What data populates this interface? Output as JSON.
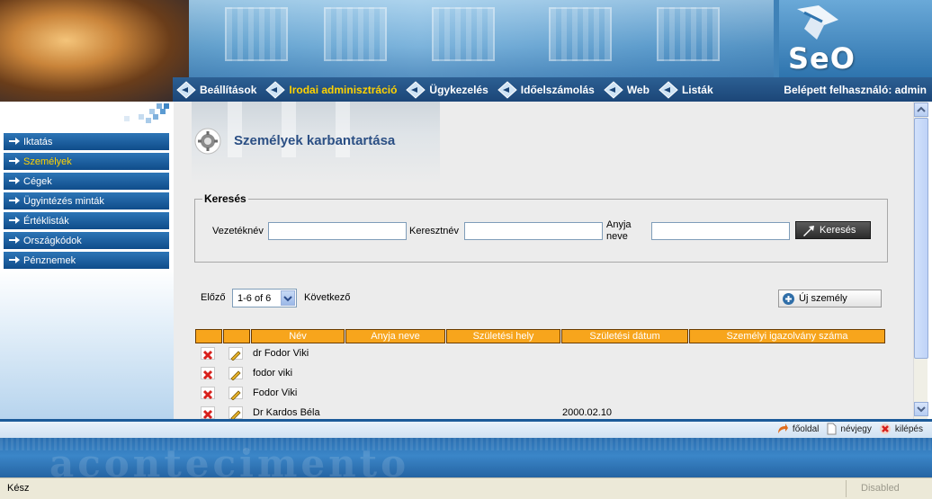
{
  "logo": {
    "text": "SeO"
  },
  "nav": {
    "items": [
      {
        "label": "Beállítások",
        "active": false
      },
      {
        "label": "Irodai adminisztráció",
        "active": true
      },
      {
        "label": "Ügykezelés",
        "active": false
      },
      {
        "label": "Időelszámolás",
        "active": false
      },
      {
        "label": "Web",
        "active": false
      },
      {
        "label": "Listák",
        "active": false
      }
    ],
    "user_label": "Belépett felhasználó: admin"
  },
  "sidebar": {
    "items": [
      {
        "label": "Iktatás",
        "active": false
      },
      {
        "label": "Személyek",
        "active": true
      },
      {
        "label": "Cégek",
        "active": false
      },
      {
        "label": "Ügyintézés minták",
        "active": false
      },
      {
        "label": "Értéklisták",
        "active": false
      },
      {
        "label": "Országkódok",
        "active": false
      },
      {
        "label": "Pénznemek",
        "active": false
      }
    ]
  },
  "page": {
    "title": "Személyek karbantartása"
  },
  "search": {
    "legend": "Keresés",
    "last_name_label": "Vezetéknév",
    "last_name_value": "",
    "first_name_label": "Keresztnév",
    "first_name_value": "",
    "mother_name_label_1": "Anyja",
    "mother_name_label_2": "neve",
    "mother_name_value": "",
    "button_label": "Keresés"
  },
  "pager": {
    "prev_label": "Előző",
    "next_label": "Következő",
    "selected": "1-6 of 6"
  },
  "new_button_label": "Új személy",
  "table": {
    "columns": [
      "Név",
      "Anyja neve",
      "Születési hely",
      "Születési dátum",
      "Személyi igazolvány száma"
    ],
    "rows": [
      {
        "name": "dr Fodor Viki",
        "mother": "",
        "birthplace": "",
        "birthdate": "",
        "id_number": ""
      },
      {
        "name": "fodor viki",
        "mother": "",
        "birthplace": "",
        "birthdate": "",
        "id_number": ""
      },
      {
        "name": "Fodor Viki",
        "mother": "",
        "birthplace": "",
        "birthdate": "",
        "id_number": ""
      },
      {
        "name": "Dr Kardos Béla",
        "mother": "",
        "birthplace": "",
        "birthdate": "2000.02.10",
        "id_number": ""
      }
    ]
  },
  "footer": {
    "links": [
      {
        "label": "főoldal",
        "icon": "home-arrow-icon"
      },
      {
        "label": "névjegy",
        "icon": "page-icon"
      },
      {
        "label": "kilépés",
        "icon": "close-icon"
      }
    ],
    "ghost_text": "acontecimento"
  },
  "status": {
    "text": "Kész",
    "zone": "Disabled"
  },
  "colors": {
    "nav_active": "#ffd200",
    "header_orange": "#f7a51c",
    "title_blue": "#2b4f84"
  }
}
